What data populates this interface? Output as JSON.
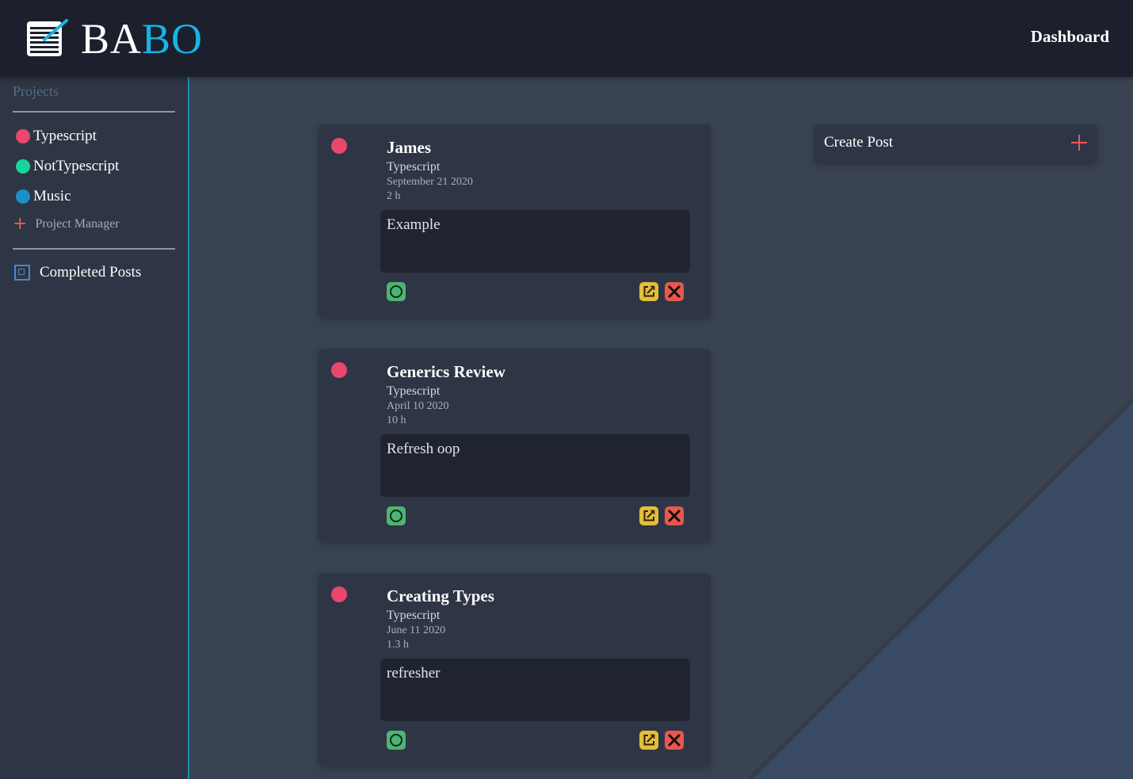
{
  "brand": {
    "part1": "BA",
    "part2": "BO"
  },
  "header": {
    "nav": "Dashboard"
  },
  "sidebar": {
    "title": "Projects",
    "projects": [
      {
        "label": "Typescript",
        "color": "#ea476d"
      },
      {
        "label": "NotTypescript",
        "color": "#18d49a"
      },
      {
        "label": "Music",
        "color": "#1991c7"
      }
    ],
    "project_manager": "Project Manager",
    "completed": "Completed Posts"
  },
  "create_post": {
    "label": "Create Post"
  },
  "posts": [
    {
      "title": "James",
      "project": "Typescript",
      "date": "September 21 2020",
      "duration": "2 h",
      "body": "Example"
    },
    {
      "title": "Generics Review",
      "project": "Typescript",
      "date": "April 10 2020",
      "duration": "10 h",
      "body": "Refresh oop"
    },
    {
      "title": "Creating Types",
      "project": "Typescript",
      "date": "June 11 2020",
      "duration": "1.3 h",
      "body": "refresher"
    }
  ]
}
